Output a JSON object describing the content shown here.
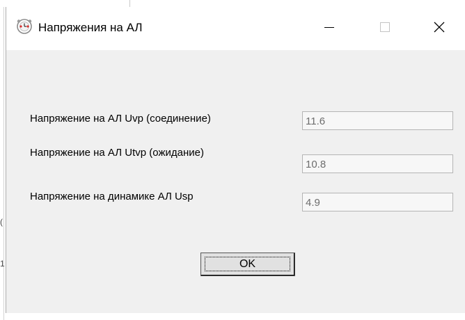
{
  "window": {
    "title": "Напряжения на АЛ",
    "app_icon": "alarm-clock-icon",
    "minimize_icon": "minimize-icon",
    "maximize_icon": "maximize-icon",
    "close_icon": "close-icon"
  },
  "fields": [
    {
      "label": "Напряжение на АЛ Uvp (соединение)",
      "value": "11.6"
    },
    {
      "label": "Напряжение на АЛ Utvp (ожидание)",
      "value": "10.8"
    },
    {
      "label": "Напряжение на динамике АЛ Usp",
      "value": "4.9"
    }
  ],
  "buttons": {
    "ok_label": "OK"
  },
  "background_window": {
    "edge_chars": [
      "(",
      "1"
    ]
  },
  "colors": {
    "dialog_background": "#f0f0f0",
    "titlebar_background": "#ffffff",
    "field_text": "#6d6d6d"
  }
}
